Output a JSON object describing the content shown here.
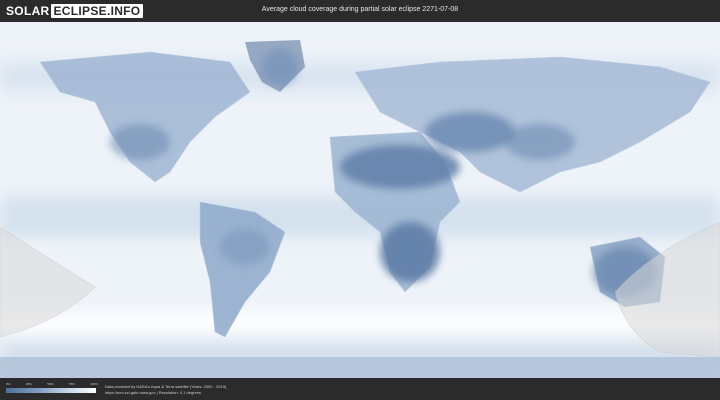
{
  "header": {
    "logo_left": "SOLAR",
    "logo_right": "ECLIPSE.INFO",
    "title": "Average cloud coverage during partial solar eclipse 2271-07-08"
  },
  "legend": {
    "ticks": [
      "0%",
      "25%",
      "50%",
      "75%",
      "100%"
    ],
    "colors": {
      "clear": "#4f6f9a",
      "mid": "#a9bfdc",
      "cloudy": "#ffffff"
    }
  },
  "footer": {
    "credit_line1": "Data provided by NASA's Aqua & Terra satellite (Years: 2000 - 2019)",
    "credit_line2": "https://neo.sci.gsfc.nasa.gov | Resolution: 0.1 degrees"
  },
  "map": {
    "projection": "equirectangular",
    "overlay_color": "#d9d9d9",
    "land_clear_color": "#6a86ad",
    "ocean_color": "#eef3f9"
  }
}
